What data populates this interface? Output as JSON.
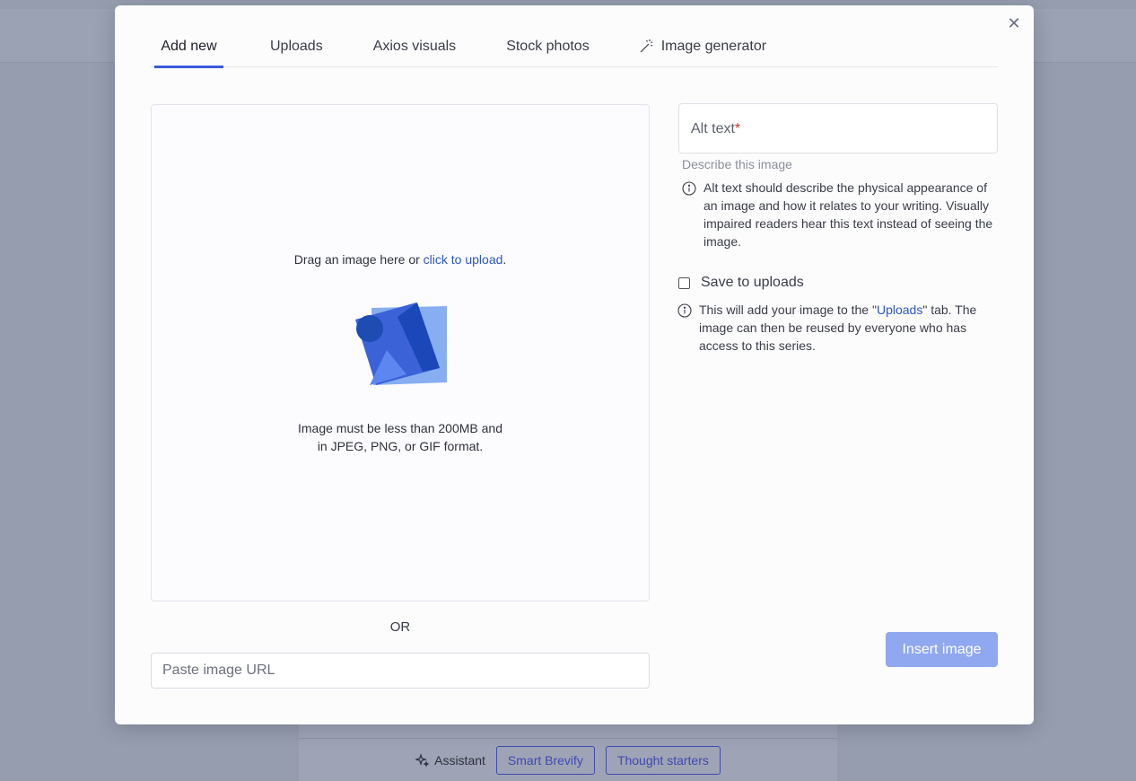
{
  "modal": {
    "tabs": [
      {
        "label": "Add new",
        "active": true
      },
      {
        "label": "Uploads"
      },
      {
        "label": "Axios visuals"
      },
      {
        "label": "Stock photos"
      },
      {
        "label": "Image generator",
        "icon": "magic-wand-icon"
      }
    ],
    "close_icon": "close-icon",
    "dropzone": {
      "drag_text": "Drag an image here or ",
      "upload_link": "click to upload",
      "drag_suffix": ".",
      "limit_line1": "Image must be less than 200MB and",
      "limit_line2": "in JPEG, PNG, or GIF format."
    },
    "or_label": "OR",
    "url_input": {
      "placeholder": "Paste image URL",
      "value": ""
    },
    "alt_text": {
      "label": "Alt text",
      "required_marker": "*",
      "helper": "Describe this image",
      "info": "Alt text should describe the physical appearance of an image and how it relates to your writing. Visually impaired readers hear this text instead of seeing the image."
    },
    "save_uploads": {
      "label": "Save to uploads",
      "checked": false,
      "info_prefix": "This will add your image to the \"",
      "info_link": "Uploads",
      "info_suffix": "\" tab. The image can then be reused by everyone who has access to this series."
    },
    "insert_button": "Insert image"
  },
  "background": {
    "assistant_label": "Assistant",
    "buttons": [
      "Smart Brevify",
      "Thought starters"
    ]
  },
  "colors": {
    "accent": "#3b5bdb",
    "link": "#2b56c8",
    "insert_disabled": "#90a8f0",
    "overlay": "#959daf"
  }
}
